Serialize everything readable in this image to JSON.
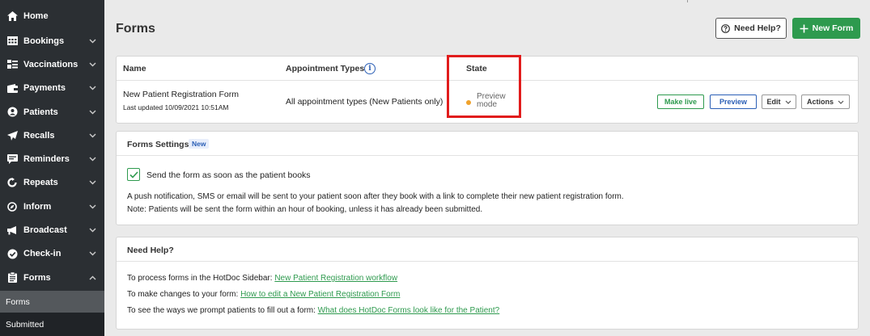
{
  "sidebar": {
    "items": [
      {
        "label": "Home",
        "icon": "home-icon",
        "chevron": false
      },
      {
        "label": "Bookings",
        "icon": "calendar-icon",
        "chevron": true
      },
      {
        "label": "Vaccinations",
        "icon": "syringe-icon",
        "chevron": true
      },
      {
        "label": "Payments",
        "icon": "wallet-icon",
        "chevron": true
      },
      {
        "label": "Patients",
        "icon": "user-circle-icon",
        "chevron": true
      },
      {
        "label": "Recalls",
        "icon": "paper-plane-icon",
        "chevron": true
      },
      {
        "label": "Reminders",
        "icon": "message-icon",
        "chevron": true
      },
      {
        "label": "Repeats",
        "icon": "refresh-icon",
        "chevron": true
      },
      {
        "label": "Inform",
        "icon": "compass-icon",
        "chevron": true
      },
      {
        "label": "Broadcast",
        "icon": "megaphone-icon",
        "chevron": true
      },
      {
        "label": "Check-in",
        "icon": "check-circle-icon",
        "chevron": true
      },
      {
        "label": "Forms",
        "icon": "clipboard-icon",
        "chevron": "up"
      }
    ],
    "subitems": [
      {
        "label": "Forms",
        "active": true
      },
      {
        "label": "Submitted",
        "active": false
      }
    ]
  },
  "header": {
    "title": "Forms",
    "help_button": "Need Help?",
    "new_button": "New Form"
  },
  "forms_table": {
    "columns": [
      "Name",
      "Appointment Types",
      "State"
    ],
    "rows": [
      {
        "name": "New Patient Registration Form",
        "updated_label": "Last updated",
        "updated_value": "10/09/2021 10:51AM",
        "appointment_types": "All appointment types (New Patients only)",
        "state": "Preview mode",
        "actions": {
          "make_live": "Make live",
          "preview": "Preview",
          "edit": "Edit",
          "more": "Actions"
        }
      }
    ]
  },
  "settings": {
    "title": "Forms Settings",
    "badge": "New",
    "checkbox_label": "Send the form as soon as the patient books",
    "checked": true,
    "line1": "A push notification, SMS or email will be sent to your patient soon after they book with a link to complete their new patient registration form.",
    "line2": "Note: Patients will be sent the form within an hour of booking, unless it has already been submitted."
  },
  "help": {
    "title": "Need Help?",
    "lines": [
      {
        "text": "To process forms in the HotDoc Sidebar: ",
        "link": "New Patient Registration workflow"
      },
      {
        "text": "To make changes to your form: ",
        "link": "How to edit a New Patient Registration Form"
      },
      {
        "text": "To see the ways we prompt patients to fill out a form: ",
        "link": "What does HotDoc Forms look like for the Patient?"
      }
    ]
  },
  "colors": {
    "sidebar_bg": "#2b2f33",
    "primary_green": "#2e9a4e",
    "primary_blue": "#2b5fb6",
    "state_dot": "#f0a22c",
    "highlight_red": "#e11c1c"
  }
}
